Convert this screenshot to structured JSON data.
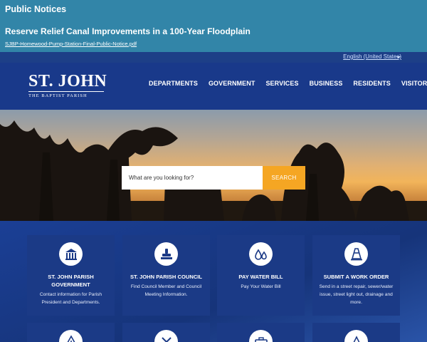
{
  "notice": {
    "title": "Public Notices",
    "headline": "Reserve Relief Canal Improvements in a 100-Year Floodplain",
    "link": "SJBP-Homewood-Pump-Station-Final-Public-Notice.pdf"
  },
  "language": {
    "selected": "English (United States)"
  },
  "logo": {
    "main": "ST. JOHN",
    "sub": "THE BAPTIST PARISH"
  },
  "nav": [
    "DEPARTMENTS",
    "GOVERNMENT",
    "SERVICES",
    "BUSINESS",
    "RESIDENTS",
    "VISITORS"
  ],
  "search": {
    "placeholder": "What are you looking for?",
    "button": "SEARCH"
  },
  "tiles": [
    {
      "title": "ST. JOHN PARISH GOVERNMENT",
      "desc": "Contact information for Parish President and Departments.",
      "icon": "building-icon"
    },
    {
      "title": "ST. JOHN PARISH COUNCIL",
      "desc": "Find Council Member and Council Meeting Information.",
      "icon": "stamp-icon"
    },
    {
      "title": "PAY WATER BILL",
      "desc": "Pay Your Water Bill",
      "icon": "water-drops-icon"
    },
    {
      "title": "SUBMIT A WORK ORDER",
      "desc": "Send in a street repair, sewer/water issue, street light out, drainage and more.",
      "icon": "traffic-cone-icon"
    }
  ],
  "lower_tiles": [
    {
      "icon": "warning-icon"
    },
    {
      "icon": "tools-icon"
    },
    {
      "icon": "briefcase-icon"
    },
    {
      "icon": "fountain-icon"
    }
  ],
  "colors": {
    "notice_bg": "#3285a8",
    "header_bg": "#19398a",
    "accent": "#f5a623",
    "tile_bg": "#1b3a86"
  }
}
